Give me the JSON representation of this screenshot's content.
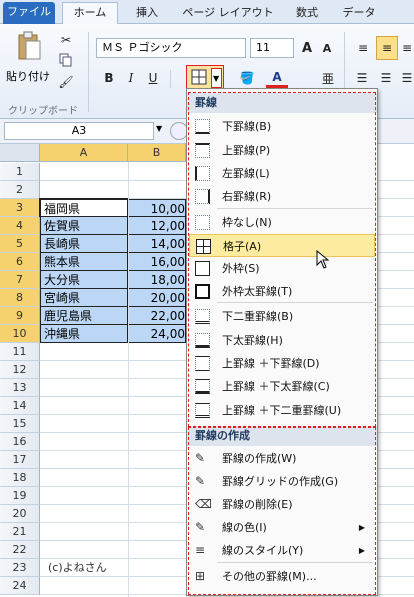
{
  "tabs": [
    {
      "id": "file",
      "label": "ファイル"
    },
    {
      "id": "home",
      "label": "ホーム"
    },
    {
      "id": "insert",
      "label": "挿入"
    },
    {
      "id": "layout",
      "label": "ページ レイアウト"
    },
    {
      "id": "formula",
      "label": "数式"
    },
    {
      "id": "data",
      "label": "データ"
    }
  ],
  "ribbon": {
    "paste_label": "貼り付け",
    "clipboard_label": "クリップボード",
    "font_name": "ＭＳ Ｐゴシック",
    "font_size": "11",
    "bold": "B",
    "italic": "I",
    "underline": "U",
    "grow_font": "A",
    "shrink_font": "A",
    "font_color": "A"
  },
  "formula_bar": {
    "name_box": "A3"
  },
  "columns": [
    "A",
    "B"
  ],
  "rows": [
    {
      "num": "1",
      "a": "",
      "b": ""
    },
    {
      "num": "2",
      "a": "",
      "b": ""
    },
    {
      "num": "3",
      "a": "福岡県",
      "b": "10,00"
    },
    {
      "num": "4",
      "a": "佐賀県",
      "b": "12,00"
    },
    {
      "num": "5",
      "a": "長崎県",
      "b": "14,00"
    },
    {
      "num": "6",
      "a": "熊本県",
      "b": "16,00"
    },
    {
      "num": "7",
      "a": "大分県",
      "b": "18,00"
    },
    {
      "num": "8",
      "a": "宮崎県",
      "b": "20,00"
    },
    {
      "num": "9",
      "a": "鹿児島県",
      "b": "22,00"
    },
    {
      "num": "10",
      "a": "沖縄県",
      "b": "24,00"
    },
    {
      "num": "11",
      "a": "",
      "b": ""
    },
    {
      "num": "12",
      "a": "",
      "b": ""
    },
    {
      "num": "13",
      "a": "",
      "b": ""
    },
    {
      "num": "14",
      "a": "",
      "b": ""
    },
    {
      "num": "15",
      "a": "",
      "b": ""
    },
    {
      "num": "16",
      "a": "",
      "b": ""
    },
    {
      "num": "17",
      "a": "",
      "b": ""
    },
    {
      "num": "18",
      "a": "",
      "b": ""
    },
    {
      "num": "19",
      "a": "",
      "b": ""
    },
    {
      "num": "20",
      "a": "",
      "b": ""
    },
    {
      "num": "21",
      "a": "",
      "b": ""
    },
    {
      "num": "22",
      "a": "",
      "b": ""
    },
    {
      "num": "23",
      "a": "(c)よねさん",
      "b": ""
    },
    {
      "num": "24",
      "a": "",
      "b": ""
    }
  ],
  "menu": {
    "borders_header": "罫線",
    "draw_header": "罫線の作成",
    "items": [
      {
        "label": "下罫線(B)",
        "hotkey": "B",
        "icon": "bottom-border-icon"
      },
      {
        "label": "上罫線(P)",
        "icon": "top-border-icon"
      },
      {
        "label": "左罫線(L)",
        "icon": "left-border-icon"
      },
      {
        "label": "右罫線(R)",
        "icon": "right-border-icon"
      },
      {
        "label": "枠なし(N)",
        "icon": "no-border-icon"
      },
      {
        "label": "格子(A)",
        "icon": "all-borders-icon"
      },
      {
        "label": "外枠(S)",
        "icon": "outside-borders-icon"
      },
      {
        "label": "外枠太罫線(T)",
        "icon": "thick-box-border-icon"
      },
      {
        "label": "下二重罫線(B)",
        "icon": "bottom-double-border-icon"
      },
      {
        "label": "下太罫線(H)",
        "icon": "thick-bottom-border-icon"
      },
      {
        "label": "上罫線 ＋下罫線(D)",
        "icon": "top-bottom-border-icon"
      },
      {
        "label": "上罫線 ＋下太罫線(C)",
        "icon": "top-thick-bottom-border-icon"
      },
      {
        "label": "上罫線 ＋下二重罫線(U)",
        "icon": "top-double-bottom-border-icon"
      }
    ],
    "draw_items": [
      {
        "label": "罫線の作成(W)",
        "icon": "draw-border-icon"
      },
      {
        "label": "罫線グリッドの作成(G)",
        "icon": "draw-border-grid-icon"
      },
      {
        "label": "罫線の削除(E)",
        "icon": "erase-border-icon"
      },
      {
        "label": "線の色(I)",
        "icon": "line-color-icon"
      },
      {
        "label": "線のスタイル(Y)",
        "icon": "line-style-icon"
      },
      {
        "label": "その他の罫線(M)...",
        "icon": "more-borders-icon"
      }
    ]
  },
  "colors": {
    "selection": "#bcd7f5",
    "header_selected": "#f6d26e",
    "highlight": "#fdeca0"
  }
}
